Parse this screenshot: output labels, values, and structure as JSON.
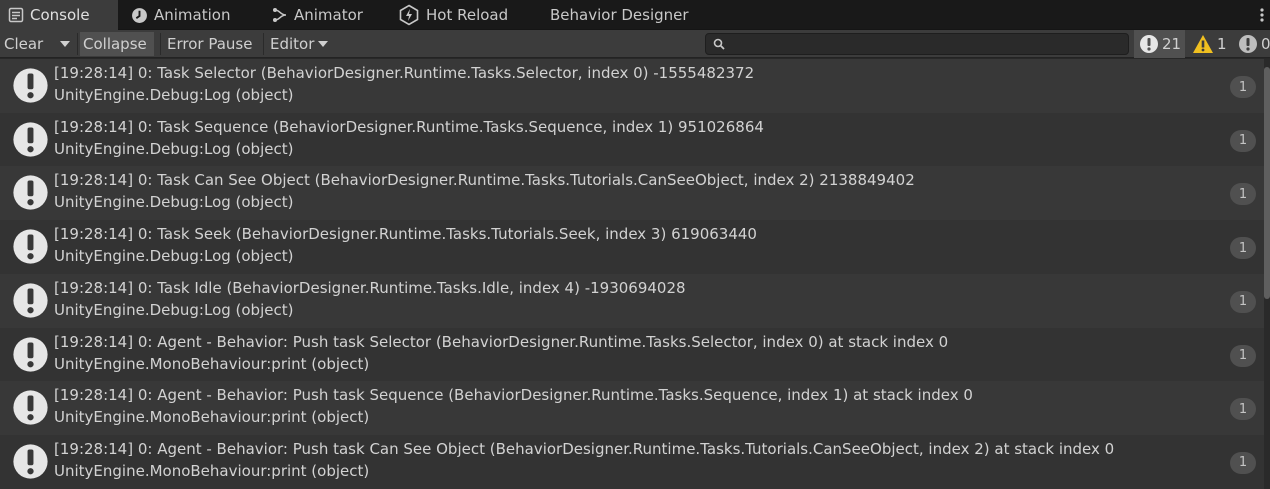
{
  "tabs": {
    "console": "Console",
    "animation": "Animation",
    "animator": "Animator",
    "hot_reload": "Hot Reload",
    "behavior_designer": "Behavior Designer"
  },
  "toolbar": {
    "clear": "Clear",
    "collapse": "Collapse",
    "error_pause": "Error Pause",
    "editor": "Editor",
    "search_value": "",
    "log_count": "21",
    "warning_count": "1",
    "error_count": "0"
  },
  "icons": {
    "log": "info-circle-icon",
    "warning": "warning-triangle-icon",
    "error": "error-circle-icon"
  },
  "colors": {
    "log_icon": "#e6e6e6",
    "warning_icon": "#f0c020",
    "accent": "#3a79bb"
  },
  "logs": [
    {
      "message": "[19:28:14] 0: Task Selector (BehaviorDesigner.Runtime.Tasks.Selector, index 0) -1555482372",
      "stack": "UnityEngine.Debug:Log (object)",
      "count": "1"
    },
    {
      "message": "[19:28:14] 0: Task Sequence (BehaviorDesigner.Runtime.Tasks.Sequence, index 1) 951026864",
      "stack": "UnityEngine.Debug:Log (object)",
      "count": "1"
    },
    {
      "message": "[19:28:14] 0: Task Can See Object (BehaviorDesigner.Runtime.Tasks.Tutorials.CanSeeObject, index 2) 2138849402",
      "stack": "UnityEngine.Debug:Log (object)",
      "count": "1"
    },
    {
      "message": "[19:28:14] 0: Task Seek (BehaviorDesigner.Runtime.Tasks.Tutorials.Seek, index 3) 619063440",
      "stack": "UnityEngine.Debug:Log (object)",
      "count": "1"
    },
    {
      "message": "[19:28:14] 0: Task Idle (BehaviorDesigner.Runtime.Tasks.Idle, index 4) -1930694028",
      "stack": "UnityEngine.Debug:Log (object)",
      "count": "1"
    },
    {
      "message": "[19:28:14] 0: Agent - Behavior: Push task Selector (BehaviorDesigner.Runtime.Tasks.Selector, index 0) at stack index 0",
      "stack": "UnityEngine.MonoBehaviour:print (object)",
      "count": "1"
    },
    {
      "message": "[19:28:14] 0: Agent - Behavior: Push task Sequence (BehaviorDesigner.Runtime.Tasks.Sequence, index 1) at stack index 0",
      "stack": "UnityEngine.MonoBehaviour:print (object)",
      "count": "1"
    },
    {
      "message": "[19:28:14] 0: Agent - Behavior: Push task Can See Object (BehaviorDesigner.Runtime.Tasks.Tutorials.CanSeeObject, index 2) at stack index 0",
      "stack": "UnityEngine.MonoBehaviour:print (object)",
      "count": "1"
    }
  ]
}
